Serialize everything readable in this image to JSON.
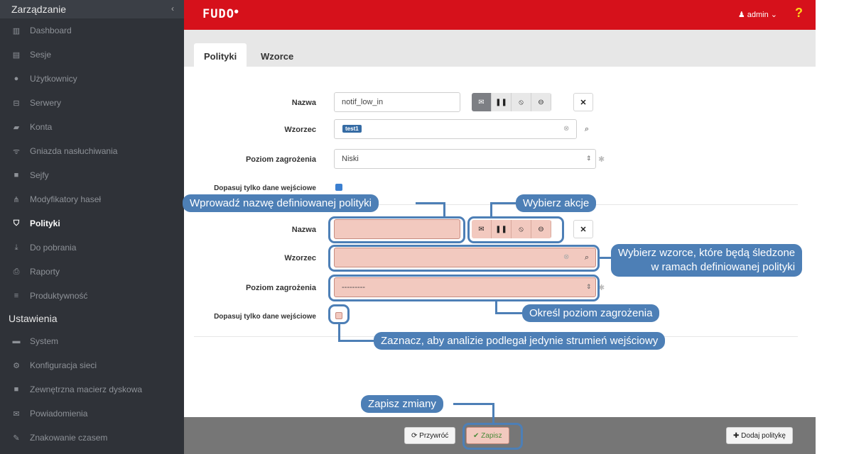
{
  "sidebar": {
    "title": "Zarządzanie",
    "collapse_icon": "chevron-left-icon",
    "items": [
      {
        "label": "Dashboard",
        "icon": "dashboard-icon"
      },
      {
        "label": "Sesje",
        "icon": "film-icon"
      },
      {
        "label": "Użytkownicy",
        "icon": "users-icon"
      },
      {
        "label": "Serwery",
        "icon": "server-icon"
      },
      {
        "label": "Konta",
        "icon": "book-icon"
      },
      {
        "label": "Gniazda nasłuchiwania",
        "icon": "rss-icon"
      },
      {
        "label": "Sejfy",
        "icon": "safe-icon"
      },
      {
        "label": "Modyfikatory haseł",
        "icon": "sitemap-icon"
      },
      {
        "label": "Polityki",
        "icon": "shield-icon",
        "active": true
      },
      {
        "label": "Do pobrania",
        "icon": "download-icon"
      },
      {
        "label": "Raporty",
        "icon": "print-icon"
      },
      {
        "label": "Produktywność",
        "icon": "bars-icon"
      }
    ],
    "settings_title": "Ustawienia",
    "settings_items": [
      {
        "label": "System",
        "icon": "folder-icon"
      },
      {
        "label": "Konfiguracja sieci",
        "icon": "cogs-icon"
      },
      {
        "label": "Zewnętrzna macierz dyskowa",
        "icon": "folder-icon"
      },
      {
        "label": "Powiadomienia",
        "icon": "envelope-icon"
      },
      {
        "label": "Znakowanie czasem",
        "icon": "edit-icon"
      }
    ]
  },
  "topbar": {
    "logo": "FUDO",
    "user": "admin",
    "help": "?"
  },
  "tabs": [
    "Polityki",
    "Wzorce"
  ],
  "policy1": {
    "name_label": "Nazwa",
    "name_value": "notif_low_in",
    "pattern_label": "Wzorzec",
    "pattern_tag": "test1",
    "threat_label": "Poziom zagrożenia",
    "threat_value": "Niski",
    "input_only_label": "Dopasuj tylko dane wejściowe"
  },
  "policy2": {
    "name_label": "Nazwa",
    "name_value": "",
    "pattern_label": "Wzorzec",
    "threat_label": "Poziom zagrożenia",
    "threat_value": "---------",
    "input_only_label": "Dopasuj tylko dane wejściowe"
  },
  "actions_icons": [
    "envelope-icon",
    "pause-icon",
    "disconnect-icon",
    "block-icon"
  ],
  "callouts": {
    "name": "Wprowadź nazwę definiowanej polityki",
    "actions": "Wybierz akcje",
    "pattern_line1": "Wybierz wzorce, które będą śledzone",
    "pattern_line2": "w ramach definiowanej polityki",
    "threat": "Określ poziom zagrożenia",
    "input_only": "Zaznacz, aby analizie podlegał jedynie strumień wejściowy",
    "save": "Zapisz zmiany"
  },
  "footer": {
    "revert": "Przywróć",
    "save": "Zapisz",
    "add_policy": "Dodaj politykę"
  },
  "colors": {
    "accent": "#d6111b",
    "callout": "#4d7fb6",
    "highlight": "#f2c9bf"
  }
}
